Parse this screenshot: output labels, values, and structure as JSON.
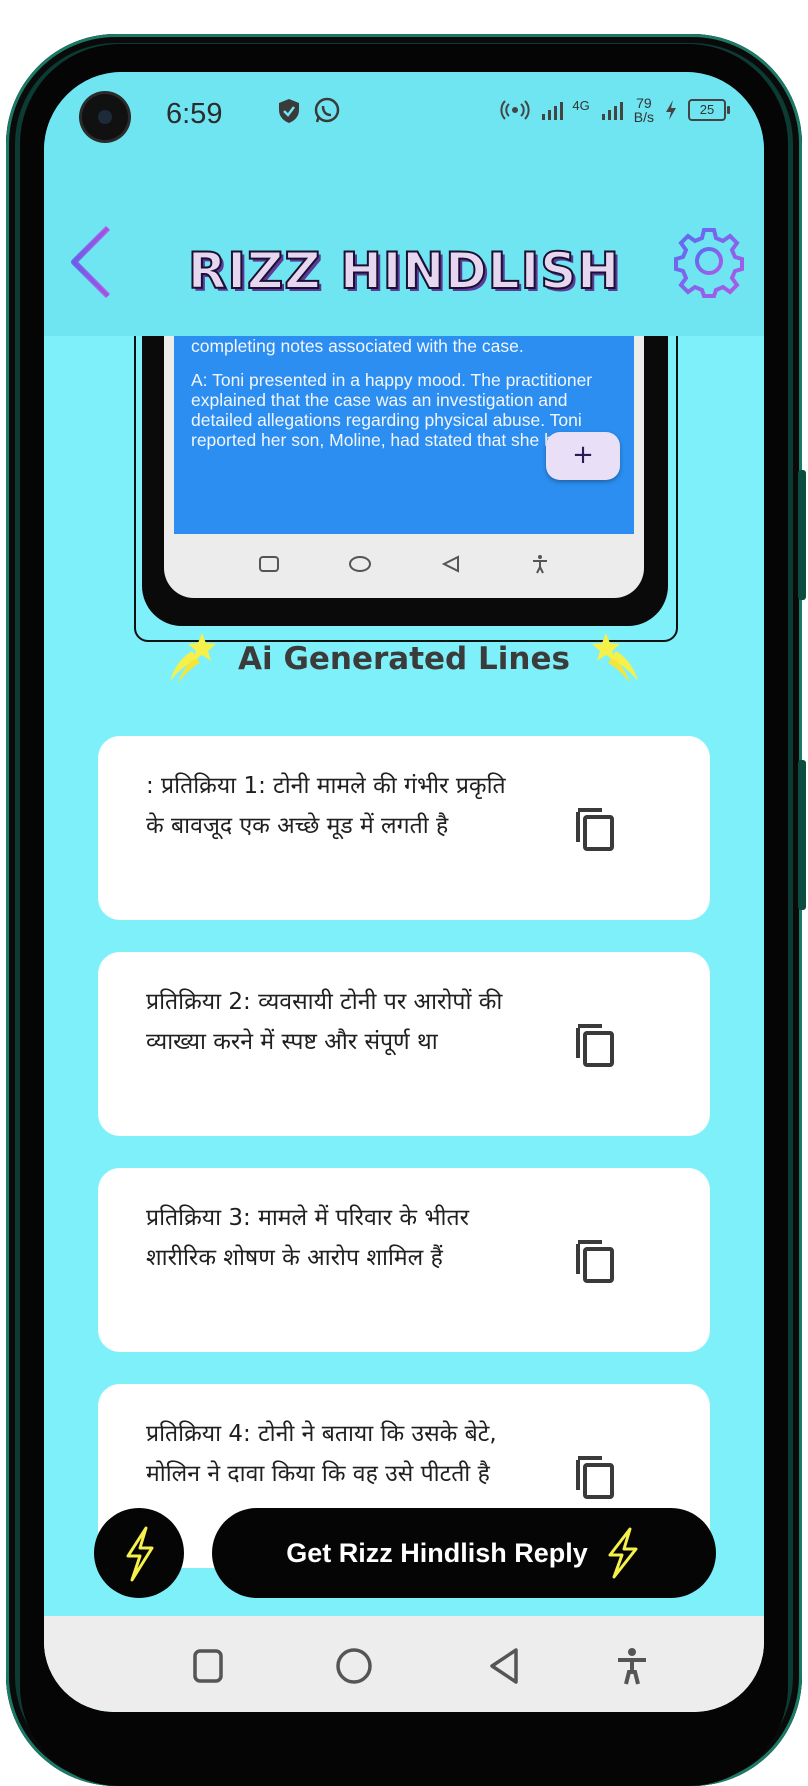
{
  "status_bar": {
    "time": "6:59",
    "network_type": "4G",
    "net_speed_value": "79",
    "net_speed_unit": "B/s",
    "battery": "25"
  },
  "app_bar": {
    "title": "RIZZ HINDLISH"
  },
  "preview": {
    "paragraph_1": "D: The practitioner met with Toni at her home to discuss allegations reported to CPS regarding physical abuse in the family. Time recorded in this note accounts for time spent during travel, interviews, and completing notes associated with the case.",
    "paragraph_2": "A: Toni presented in a happy mood. The practitioner explained that the case was an investigation and detailed allegations regarding physical abuse. Toni reported her son, Moline, had stated that she hit him",
    "fab_label": "+"
  },
  "section": {
    "title": "Ai Generated Lines"
  },
  "responses": [
    {
      "text": ": प्रतिक्रिया 1: टोनी मामले की गंभीर प्रकृति के बावजूद एक अच्छे मूड में लगती है"
    },
    {
      "text": "प्रतिक्रिया 2: व्यवसायी टोनी पर आरोपों की व्याख्या करने में स्पष्ट और संपूर्ण था"
    },
    {
      "text": "प्रतिक्रिया 3: मामले में परिवार के भीतर शारीरिक शोषण के आरोप शामिल हैं"
    },
    {
      "text": "प्रतिक्रिया 4: टोनी ने बताया कि उसके बेटे, मोलिन ने दावा किया कि वह उसे पीटती है"
    }
  ],
  "action": {
    "label": "Get Rizz Hindlish Reply"
  },
  "colors": {
    "background": "#7ef0f9",
    "app_bar": "#6fe5f1",
    "card": "#ffffff",
    "button": "#050505",
    "lightning": "#f5f04a",
    "preview_text_bg": "#2b8ef0"
  },
  "icons": {
    "back": "back-chevron-icon",
    "settings": "gear-icon",
    "copy": "copy-icon",
    "lightning": "lightning-icon",
    "star": "shooting-star-icon"
  }
}
